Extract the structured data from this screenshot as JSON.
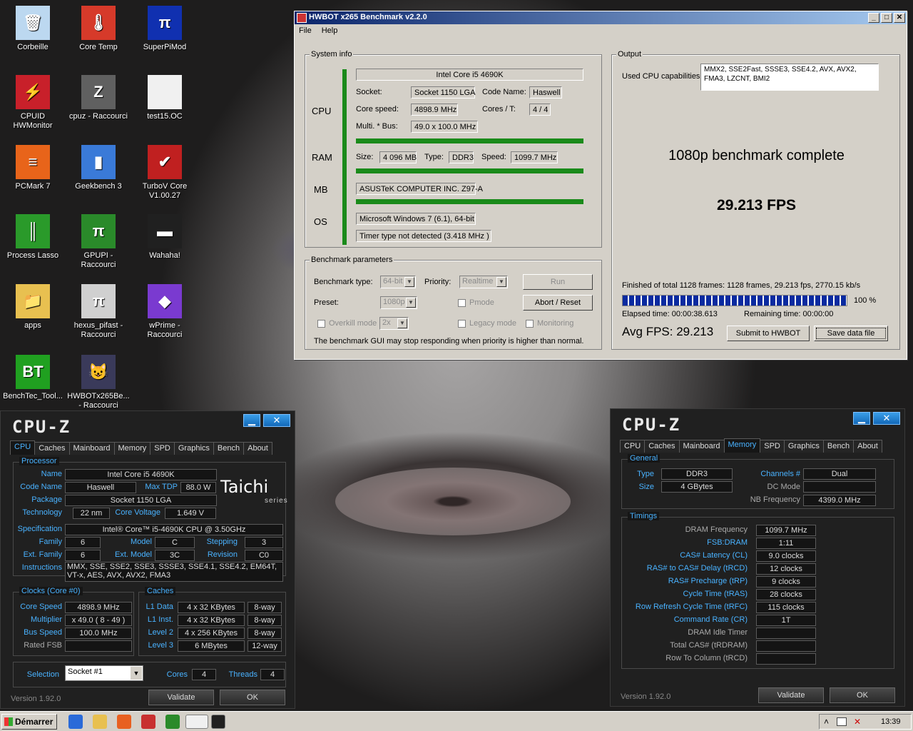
{
  "desktop": {
    "icons": [
      {
        "label": "Corbeille",
        "color": "#bcd8f0",
        "glyph": "🗑"
      },
      {
        "label": "Core Temp",
        "color": "#d63a2a",
        "glyph": "🌡"
      },
      {
        "label": "SuperPiMod",
        "color": "#1030b0",
        "glyph": "π"
      },
      {
        "label": "CPUID HWMonitor",
        "color": "#c8202a",
        "glyph": "⚡"
      },
      {
        "label": "cpuz - Raccourci",
        "color": "#606060",
        "glyph": "Z"
      },
      {
        "label": "test15.OC",
        "color": "#f0f0f0",
        "glyph": ""
      },
      {
        "label": "PCMark 7",
        "color": "#e8641a",
        "glyph": "≡"
      },
      {
        "label": "Geekbench 3",
        "color": "#3a7ad8",
        "glyph": "▮"
      },
      {
        "label": "TurboV Core V1.00.27",
        "color": "#c02020",
        "glyph": "✔"
      },
      {
        "label": "Process Lasso",
        "color": "#2a9a2a",
        "glyph": "║"
      },
      {
        "label": "GPUPI - Raccourci",
        "color": "#2a8a2a",
        "glyph": "π"
      },
      {
        "label": "Wahaha!",
        "color": "#202020",
        "glyph": "▬"
      },
      {
        "label": "apps",
        "color": "#e8c050",
        "glyph": "📁"
      },
      {
        "label": "hexus_pifast - Raccourci",
        "color": "#d0d0d0",
        "glyph": "π"
      },
      {
        "label": "wPrime - Raccourci",
        "color": "#7a3ad0",
        "glyph": "◆"
      },
      {
        "label": "BenchTec_Tool...",
        "color": "#20a020",
        "glyph": "BT"
      },
      {
        "label": "HWBOTx265Be... - Raccourci",
        "color": "#3a3a5a",
        "glyph": "😺"
      }
    ]
  },
  "hwbot": {
    "title": "HWBOT x265 Benchmark v2.2.0",
    "menu": [
      "File",
      "Help"
    ],
    "system_info": {
      "title": "System info",
      "cpu_section": "CPU",
      "ram_section": "RAM",
      "mb_section": "MB",
      "os_section": "OS",
      "cpu_name": "Intel Core i5 4690K",
      "socket_label": "Socket:",
      "socket": "Socket 1150 LGA",
      "codename_label": "Code Name:",
      "codename": "Haswell",
      "speed_label": "Core speed:",
      "speed": "4898.9 MHz",
      "cores_label": "Cores / T:",
      "cores": "4 / 4",
      "multi_label": "Multi. * Bus:",
      "multi": "49.0 x 100.0 MHz",
      "ram_size_label": "Size:",
      "ram_size": "4 096 MB",
      "ram_type_label": "Type:",
      "ram_type": "DDR3",
      "ram_speed_label": "Speed:",
      "ram_speed": "1099.7 MHz",
      "mb": "ASUSTeK COMPUTER INC. Z97-A",
      "os": "Microsoft Windows 7 (6.1), 64-bit",
      "timer": "Timer type not detected (3.418 MHz )"
    },
    "params": {
      "title": "Benchmark parameters",
      "type_label": "Benchmark type:",
      "type": "64-bit",
      "priority_label": "Priority:",
      "priority": "Realtime",
      "run": "Run",
      "preset_label": "Preset:",
      "preset": "1080p",
      "pmode": "Pmode",
      "abort": "Abort / Reset",
      "overkill": "Overkill mode",
      "overkill_val": "2x",
      "legacy": "Legacy mode",
      "monitoring": "Monitoring",
      "note": "The benchmark GUI may stop responding when priority is higher than normal."
    },
    "output": {
      "title": "Output",
      "caps_label": "Used CPU capabilities:",
      "caps": "MMX2, SSE2Fast, SSSE3, SSE4.2, AVX, AVX2, FMA3, LZCNT, BMI2",
      "status": "1080p benchmark complete",
      "fps": "29.213 FPS",
      "finished": "Finished of total 1128 frames: 1128 frames, 29.213 fps,  2770.15 kb/s",
      "progress": 1.0,
      "percent": "100 %",
      "elapsed": "Elapsed time: 00:00:38.613",
      "remaining": "Remaining time: 00:00:00",
      "avg": "Avg FPS: 29.213",
      "submit": "Submit to HWBOT",
      "save": "Save data file"
    }
  },
  "cpuz_left": {
    "logo": "CPU-Z",
    "tabs": [
      "CPU",
      "Caches",
      "Mainboard",
      "Memory",
      "SPD",
      "Graphics",
      "Bench",
      "About"
    ],
    "active_tab": "CPU",
    "processor": {
      "title": "Processor",
      "name_label": "Name",
      "name": "Intel Core i5 4690K",
      "code_label": "Code Name",
      "code": "Haswell",
      "tdp_label": "Max TDP",
      "tdp": "88.0 W",
      "package_label": "Package",
      "package": "Socket 1150 LGA",
      "tech_label": "Technology",
      "tech": "22 nm",
      "voltage_label": "Core Voltage",
      "voltage": "1.649 V",
      "spec_label": "Specification",
      "spec": "Intel® Core™ i5-4690K CPU @ 3.50GHz",
      "family_label": "Family",
      "family": "6",
      "model_label": "Model",
      "model": "C",
      "stepping_label": "Stepping",
      "stepping": "3",
      "extfam_label": "Ext. Family",
      "extfam": "6",
      "extmodel_label": "Ext. Model",
      "extmodel": "3C",
      "revision_label": "Revision",
      "revision": "C0",
      "instr_label": "Instructions",
      "instr": "MMX, SSE, SSE2, SSE3, SSSE3, SSE4.1, SSE4.2, EM64T, VT-x, AES, AVX, AVX2, FMA3",
      "brand": "Taichi",
      "brand_sub": "series"
    },
    "clocks": {
      "title": "Clocks (Core #0)",
      "speed_label": "Core Speed",
      "speed": "4898.9 MHz",
      "mult_label": "Multiplier",
      "mult": "x 49.0 ( 8 - 49 )",
      "bus_label": "Bus Speed",
      "bus": "100.0 MHz",
      "fsb_label": "Rated FSB",
      "fsb": ""
    },
    "caches": {
      "title": "Caches",
      "l1d_label": "L1 Data",
      "l1d": "4 x 32 KBytes",
      "l1d_w": "8-way",
      "l1i_label": "L1 Inst.",
      "l1i": "4 x 32 KBytes",
      "l1i_w": "8-way",
      "l2_label": "Level 2",
      "l2": "4 x 256 KBytes",
      "l2_w": "8-way",
      "l3_label": "Level 3",
      "l3": "6 MBytes",
      "l3_w": "12-way"
    },
    "sel_label": "Selection",
    "sel": "Socket #1",
    "cores_label": "Cores",
    "cores": "4",
    "threads_label": "Threads",
    "threads": "4",
    "version": "Version 1.92.0",
    "validate": "Validate",
    "ok": "OK"
  },
  "cpuz_right": {
    "logo": "CPU-Z",
    "tabs": [
      "CPU",
      "Caches",
      "Mainboard",
      "Memory",
      "SPD",
      "Graphics",
      "Bench",
      "About"
    ],
    "active_tab": "Memory",
    "general": {
      "title": "General",
      "type_label": "Type",
      "type": "DDR3",
      "size_label": "Size",
      "size": "4 GBytes",
      "channels_label": "Channels #",
      "channels": "Dual",
      "dc_label": "DC Mode",
      "dc": "",
      "nb_label": "NB Frequency",
      "nb": "4399.0 MHz"
    },
    "timings": {
      "title": "Timings",
      "rows": [
        {
          "label": "DRAM Frequency",
          "value": "1099.7 MHz",
          "grey": true
        },
        {
          "label": "FSB:DRAM",
          "value": "1:11",
          "grey": false
        },
        {
          "label": "CAS# Latency (CL)",
          "value": "9.0 clocks",
          "grey": false
        },
        {
          "label": "RAS# to CAS# Delay (tRCD)",
          "value": "12 clocks",
          "grey": false
        },
        {
          "label": "RAS# Precharge (tRP)",
          "value": "9 clocks",
          "grey": false
        },
        {
          "label": "Cycle Time (tRAS)",
          "value": "28 clocks",
          "grey": false
        },
        {
          "label": "Row Refresh Cycle Time (tRFC)",
          "value": "115 clocks",
          "grey": false
        },
        {
          "label": "Command Rate (CR)",
          "value": "1T",
          "grey": false
        },
        {
          "label": "DRAM Idle Timer",
          "value": "",
          "grey": true
        },
        {
          "label": "Total CAS# (tRDRAM)",
          "value": "",
          "grey": true
        },
        {
          "label": "Row To Column (tRCD)",
          "value": "",
          "grey": true
        }
      ]
    },
    "version": "Version 1.92.0",
    "validate": "Validate",
    "ok": "OK"
  },
  "taskbar": {
    "start": "Démarrer",
    "clock": "13:39"
  }
}
